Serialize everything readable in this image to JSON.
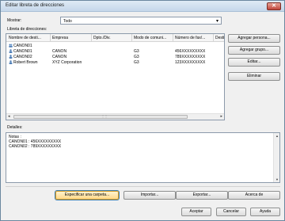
{
  "window": {
    "title": "Editar libreta de direcciones",
    "close_glyph": "✕"
  },
  "show": {
    "label": "Mostrar:",
    "value": "Todo"
  },
  "book": {
    "label": "Libreta de direcciones:",
    "columns": [
      "Nombre de desti...",
      "Empresa",
      "Dpto./Div.",
      "Modo de comuni...",
      "Número de fax/...",
      "Desti"
    ],
    "rows": [
      {
        "icon": "group-icon",
        "name": "CANON01",
        "company": "",
        "dept": "",
        "mode": "",
        "number": ""
      },
      {
        "icon": "person-icon",
        "name": "CANON01",
        "company": "CANON",
        "dept": "",
        "mode": "G3",
        "number": "456XXXXXXXXX"
      },
      {
        "icon": "person-icon",
        "name": "CANON02",
        "company": "CANON",
        "dept": "",
        "mode": "G3",
        "number": "789XXXXXXXXX"
      },
      {
        "icon": "person-icon",
        "name": "Robert Brown",
        "company": "XYZ Corporation",
        "dept": "",
        "mode": "G3",
        "number": "123XXXXXXXXX"
      }
    ]
  },
  "side_buttons": {
    "add_person": "Agregar persona...",
    "add_group": "Agregar grupo...",
    "edit": "Editar...",
    "delete": "Eliminar"
  },
  "details": {
    "label": "Detalles:",
    "lines": [
      "Notas   :",
      "CANON01 : 456XXXXXXXXX",
      "CANON02 : 789XXXXXXXXX"
    ]
  },
  "bottom_buttons": {
    "specify_folder": "Especificar una carpeta...",
    "import": "Importar...",
    "export": "Exportar...",
    "about": "Acerca de"
  },
  "dialog_buttons": {
    "ok": "Aceptar",
    "cancel": "Cancelar",
    "help": "Ayuda"
  }
}
